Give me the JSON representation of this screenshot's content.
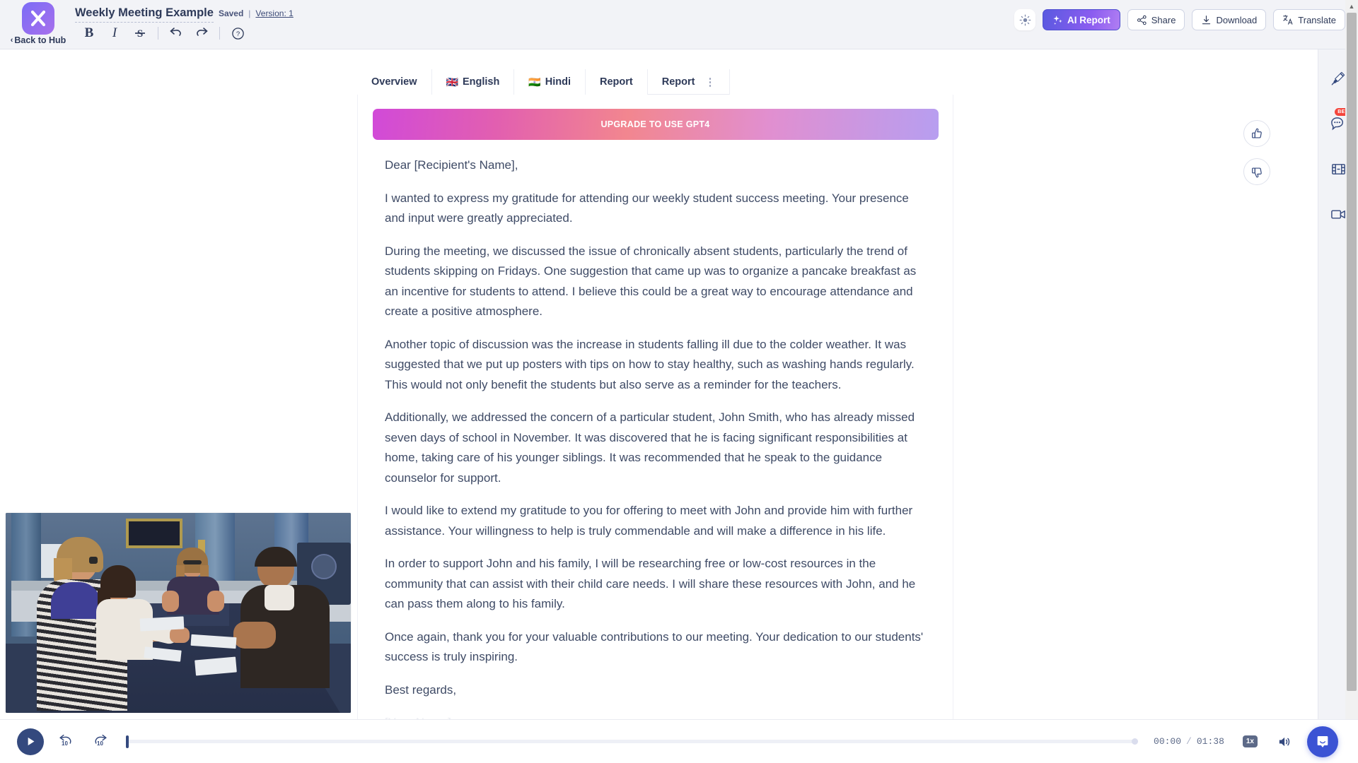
{
  "app": {
    "logo_icon": "x-logo-icon",
    "back_label": "Back to Hub",
    "back_chevron": "‹"
  },
  "header": {
    "doc_title": "Weekly Meeting Example",
    "saved_label": "Saved",
    "separator": "|",
    "version_label": "Version: 1",
    "format_tools": [
      {
        "name": "bold",
        "glyph": "B"
      },
      {
        "name": "italic",
        "glyph": "I"
      },
      {
        "name": "strikethrough",
        "glyph": "S"
      },
      {
        "name": "undo",
        "glyph": "↩"
      },
      {
        "name": "redo",
        "glyph": "↪"
      },
      {
        "name": "help",
        "glyph": "?"
      }
    ],
    "actions": {
      "theme_icon": "brightness-icon",
      "ai_report": "AI Report",
      "share": "Share",
      "download": "Download",
      "translate": "Translate"
    }
  },
  "tabs": [
    {
      "label": "Overview",
      "flag": "",
      "active": false
    },
    {
      "label": "English",
      "flag": "🇬🇧",
      "active": false
    },
    {
      "label": "Hindi",
      "flag": "🇮🇳",
      "active": false
    },
    {
      "label": "Report",
      "flag": "",
      "active": false
    },
    {
      "label": "Report",
      "flag": "",
      "active": true,
      "kebab": "⋮"
    }
  ],
  "banner": {
    "text": "UPGRADE TO USE GPT4",
    "gradient_start": "#d14ad8",
    "gradient_mid": "#f2868f",
    "gradient_end": "#b79ef0"
  },
  "document": {
    "paragraphs": [
      "Dear [Recipient's Name],",
      "I wanted to express my gratitude for attending our weekly student success meeting. Your presence and input were greatly appreciated.",
      "During the meeting, we discussed the issue of chronically absent students, particularly the trend of students skipping on Fridays. One suggestion that came up was to organize a pancake breakfast as an incentive for students to attend. I believe this could be a great way to encourage attendance and create a positive atmosphere.",
      "Another topic of discussion was the increase in students falling ill due to the colder weather. It was suggested that we put up posters with tips on how to stay healthy, such as washing hands regularly. This would not only benefit the students but also serve as a reminder for the teachers.",
      "Additionally, we addressed the concern of a particular student, John Smith, who has already missed seven days of school in November. It was discovered that he is facing significant responsibilities at home, taking care of his younger siblings. It was recommended that he speak to the guidance counselor for support.",
      "I would like to extend my gratitude to you for offering to meet with John and provide him with further assistance. Your willingness to help is truly commendable and will make a difference in his life.",
      "In order to support John and his family, I will be researching free or low-cost resources in the community that can assist with their child care needs. I will share these resources with John, and he can pass them along to his family.",
      "Once again, thank you for your valuable contributions to our meeting. Your dedication to our students' success is truly inspiring.",
      "Best regards,"
    ],
    "faded_tail": "[Your Name]"
  },
  "feedback": {
    "thumbs_up_icon": "thumbs-up-icon",
    "thumbs_down_icon": "thumbs-down-icon"
  },
  "right_rail": [
    {
      "name": "highlighter-icon",
      "badge": ""
    },
    {
      "name": "chat-bubble-icon",
      "badge": "BETA"
    },
    {
      "name": "film-strip-icon",
      "badge": ""
    },
    {
      "name": "video-camera-icon",
      "badge": ""
    }
  ],
  "player": {
    "play_icon": "play-icon",
    "rewind_label": "10",
    "forward_label": "10",
    "current_time": "00:00",
    "time_separator": "/",
    "total_time": "01:38",
    "speed": "1x",
    "volume_icon": "volume-icon",
    "intercom_icon": "intercom-chat-icon",
    "progress_percent": 0
  },
  "colors": {
    "accent": "#34497e",
    "brand_purple": "#7b6cf6",
    "intercom_blue": "#3b53d4",
    "beta_red": "#f4453c"
  }
}
